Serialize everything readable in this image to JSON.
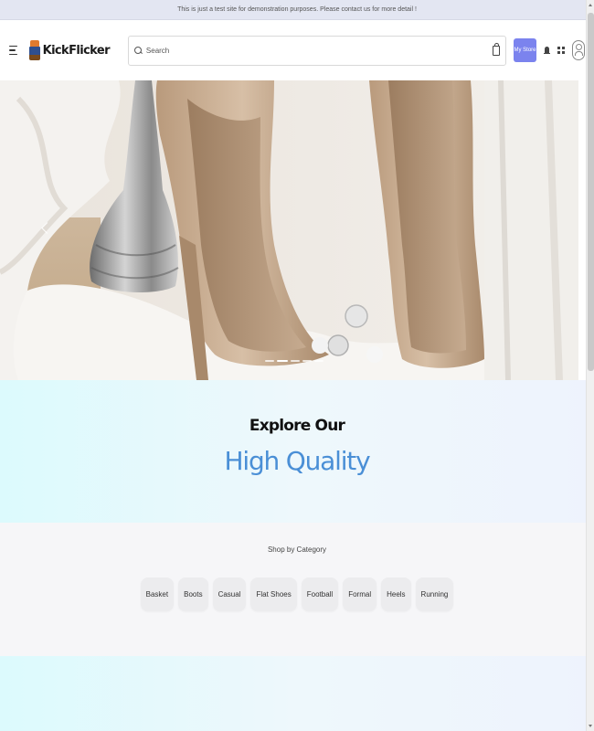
{
  "announcement": "This is just a test site for demonstration purposes. Please contact us for more detail !",
  "header": {
    "brand": "KickFlicker",
    "search_placeholder": "Search",
    "my_store_label": "My Store"
  },
  "hero": {
    "slide_count": 5,
    "active_slide": 2
  },
  "explore": {
    "title": "Explore Our",
    "subtitle": "High Quality"
  },
  "category": {
    "title": "Shop by Category",
    "items": [
      {
        "label": "Basket"
      },
      {
        "label": "Boots"
      },
      {
        "label": "Casual"
      },
      {
        "label": "Flat Shoes"
      },
      {
        "label": "Football"
      },
      {
        "label": "Formal"
      },
      {
        "label": "Heels"
      },
      {
        "label": "Running"
      }
    ]
  },
  "colors": {
    "accent": "#7b83ee",
    "subtitle": "#4a8fd6"
  },
  "icons": [
    "menu-icon",
    "brand-logo-icon",
    "search-icon",
    "bag-icon",
    "bell-icon",
    "grid-icon",
    "avatar-icon",
    "chevron-left-icon"
  ]
}
